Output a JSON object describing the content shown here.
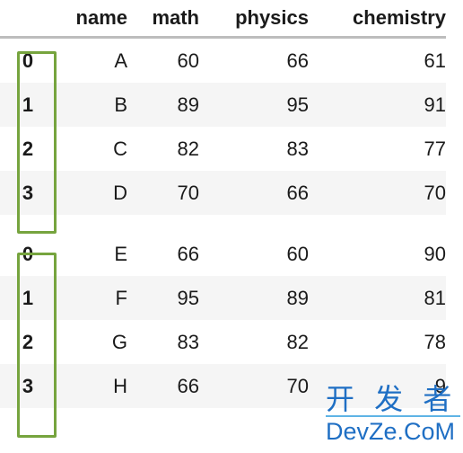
{
  "table": {
    "columns": [
      {
        "key": "index",
        "label": ""
      },
      {
        "key": "name",
        "label": "name"
      },
      {
        "key": "math",
        "label": "math"
      },
      {
        "key": "physics",
        "label": "physics"
      },
      {
        "key": "chemistry",
        "label": "chemistry"
      }
    ],
    "blocks": [
      {
        "rows": [
          {
            "index": "0",
            "name": "A",
            "math": "60",
            "physics": "66",
            "chemistry": "61"
          },
          {
            "index": "1",
            "name": "B",
            "math": "89",
            "physics": "95",
            "chemistry": "91"
          },
          {
            "index": "2",
            "name": "C",
            "math": "82",
            "physics": "83",
            "chemistry": "77"
          },
          {
            "index": "3",
            "name": "D",
            "math": "70",
            "physics": "66",
            "chemistry": "70"
          }
        ]
      },
      {
        "rows": [
          {
            "index": "0",
            "name": "E",
            "math": "66",
            "physics": "60",
            "chemistry": "90"
          },
          {
            "index": "1",
            "name": "F",
            "math": "95",
            "physics": "89",
            "chemistry": "81"
          },
          {
            "index": "2",
            "name": "G",
            "math": "83",
            "physics": "82",
            "chemistry": "78"
          },
          {
            "index": "3",
            "name": "H",
            "math": "66",
            "physics": "70",
            "chemistry": "9"
          }
        ]
      }
    ]
  },
  "annotations": {
    "color": "#76a43e",
    "boxes": [
      {
        "name": "index-column-highlight-block-1"
      },
      {
        "name": "index-column-highlight-block-2"
      }
    ]
  },
  "watermark": {
    "chinese": "开 发 者",
    "site": "DevZe.CoM",
    "color": "#1f6fc4"
  },
  "colors": {
    "text": "#1a1a1a",
    "header_rule": "#bdbdbd",
    "row_alt_background": "#f5f5f5",
    "background": "#ffffff"
  }
}
